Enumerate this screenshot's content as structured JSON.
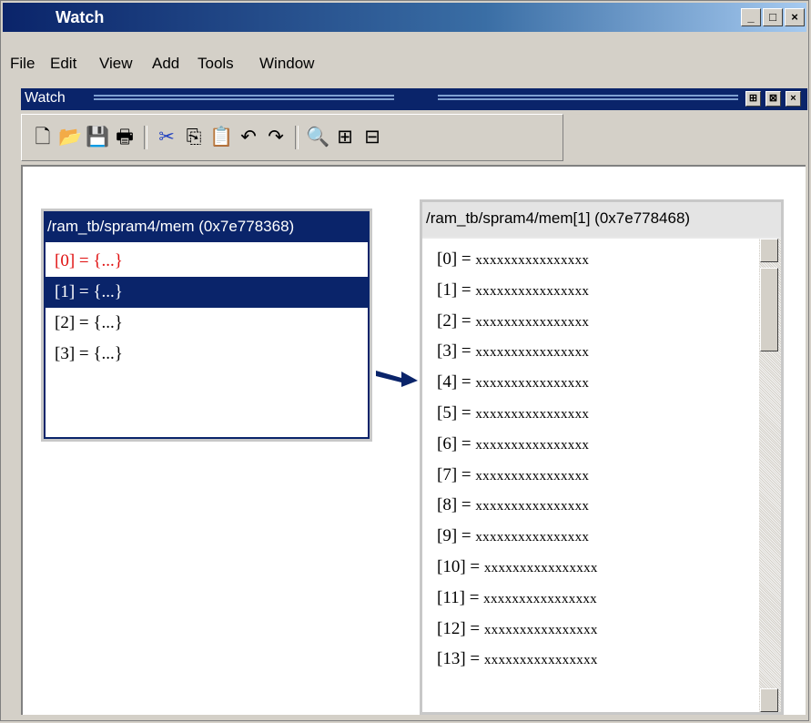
{
  "window": {
    "title": "Watch"
  },
  "titlebar_buttons": [
    "_",
    "□",
    "×"
  ],
  "menu": [
    "File",
    "Edit",
    "View",
    "Add",
    "Tools",
    "Window"
  ],
  "subwindow": {
    "title": "Watch"
  },
  "subwindow_buttons": [
    "⊞",
    "⊠",
    "×"
  ],
  "toolbar": {
    "icons": [
      "new-file-icon",
      "open-folder-icon",
      "save-icon",
      "print-icon",
      "cut-icon",
      "copy-icon",
      "paste-icon",
      "undo-icon",
      "redo-icon",
      "find-icon",
      "expand-icon",
      "collapse-icon"
    ],
    "glyphs": [
      "🗋",
      "📂",
      "💾",
      "🖶",
      "✂",
      "⎘",
      "📋",
      "↶",
      "↷",
      "🔍",
      "⊞",
      "⊟"
    ]
  },
  "panel_mem": {
    "title": "/ram_tb/spram4/mem (0x7e778368)",
    "rows": [
      {
        "text": "[0] = {...}",
        "state": "changed"
      },
      {
        "text": "[1] = {...}",
        "state": "selected"
      },
      {
        "text": "[2] = {...}",
        "state": "normal"
      },
      {
        "text": "[3] = {...}",
        "state": "normal"
      }
    ]
  },
  "panel_mem1": {
    "title": "/ram_tb/spram4/mem[1] (0x7e778468)",
    "rows": [
      {
        "index": "[0] = ",
        "value": "xxxxxxxxxxxxxxxx"
      },
      {
        "index": "[1] = ",
        "value": "xxxxxxxxxxxxxxxx"
      },
      {
        "index": "[2] = ",
        "value": "xxxxxxxxxxxxxxxx"
      },
      {
        "index": "[3] = ",
        "value": "xxxxxxxxxxxxxxxx"
      },
      {
        "index": "[4] = ",
        "value": "xxxxxxxxxxxxxxxx"
      },
      {
        "index": "[5] = ",
        "value": "xxxxxxxxxxxxxxxx"
      },
      {
        "index": "[6] = ",
        "value": "xxxxxxxxxxxxxxxx"
      },
      {
        "index": "[7] = ",
        "value": "xxxxxxxxxxxxxxxx"
      },
      {
        "index": "[8] = ",
        "value": "xxxxxxxxxxxxxxxx"
      },
      {
        "index": "[9] = ",
        "value": "xxxxxxxxxxxxxxxx"
      },
      {
        "index": "[10] = ",
        "value": "xxxxxxxxxxxxxxxx"
      },
      {
        "index": "[11] = ",
        "value": "xxxxxxxxxxxxxxxx"
      },
      {
        "index": "[12] = ",
        "value": "xxxxxxxxxxxxxxxx"
      },
      {
        "index": "[13] = ",
        "value": "xxxxxxxxxxxxxxxx"
      }
    ]
  },
  "colors": {
    "titlebar": "#0a246a",
    "changed": "#e01010",
    "selection": "#0a246a"
  }
}
